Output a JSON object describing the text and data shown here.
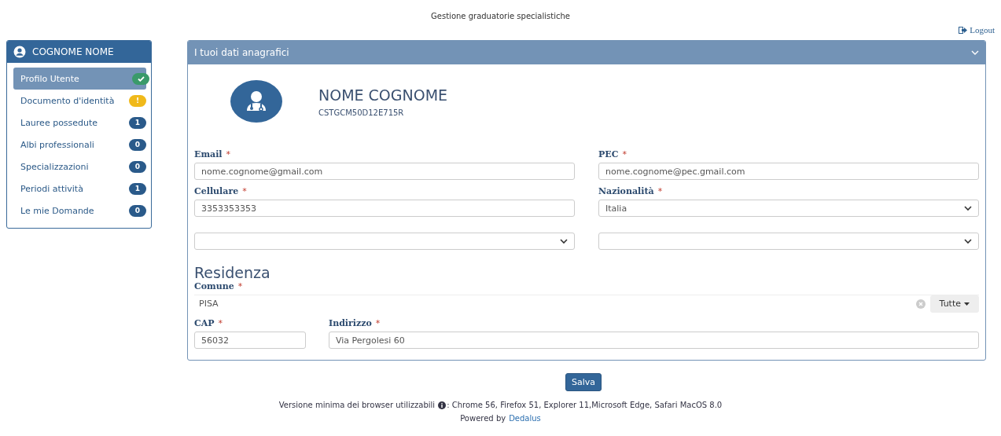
{
  "header": {
    "title": "Gestione graduatorie specialistiche",
    "logout": "Logout"
  },
  "sidebar": {
    "user": "COGNOME NOME",
    "items": [
      {
        "label": "Profilo Utente",
        "selected": true,
        "kind": "check"
      },
      {
        "label": "Documento d'identità",
        "selected": false,
        "kind": "warning",
        "badge": "!"
      },
      {
        "label": "Lauree possedute",
        "selected": false,
        "kind": "count",
        "badge": "1"
      },
      {
        "label": "Albi professionali",
        "selected": false,
        "kind": "count",
        "badge": "0"
      },
      {
        "label": "Specializzazioni",
        "selected": false,
        "kind": "count",
        "badge": "0"
      },
      {
        "label": "Periodi attività",
        "selected": false,
        "kind": "count",
        "badge": "1"
      },
      {
        "label": "Le mie Domande",
        "selected": false,
        "kind": "count",
        "badge": "0"
      }
    ]
  },
  "panel": {
    "title": "I tuoi dati anagrafici",
    "expanded": true,
    "profile": {
      "name": "NOME COGNOME",
      "code": "CSTGCM50D12E715R"
    },
    "fields": [
      {
        "label": "Email",
        "required_mark": "*",
        "kind": "text",
        "value": "nome.cognome@gmail.com"
      },
      {
        "label": "PEC",
        "required_mark": "*",
        "kind": "text",
        "value": "nome.cognome@pec.gmail.com"
      },
      {
        "label": "Cellulare",
        "required_mark": "*",
        "kind": "text",
        "value": "3353353353"
      },
      {
        "label": "Nazionalità",
        "required_mark": "*",
        "kind": "select",
        "value": "Italia"
      },
      {
        "kind": "select"
      },
      {
        "kind": "select"
      }
    ],
    "residence": {
      "title": "Residenza",
      "comune": {
        "label": "Comune",
        "required_mark": "*",
        "value": "PISA",
        "filter": "Tutte"
      },
      "cap": {
        "label": "CAP",
        "required_mark": "*",
        "value": "56032"
      },
      "address": {
        "label": "Indirizzo",
        "required_mark": "*",
        "value": "Via Pergolesi 60"
      }
    }
  },
  "save_button": "Salva",
  "footer": {
    "browsers_label": "Versione minima dei browser utilizzabili",
    "browsers": ": Chrome 56, Firefox 51, Explorer 11,Microsoft Edge, Safari MacOS 8.0",
    "powered": "Powered by",
    "powered_link": "Dedalus"
  }
}
